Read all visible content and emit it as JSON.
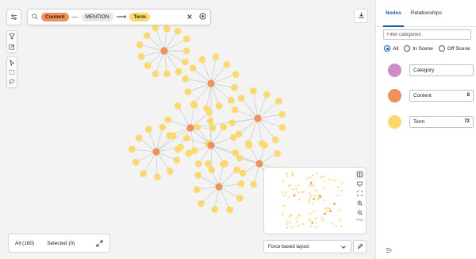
{
  "toolbar": {
    "filter_icon": "sliders-icon"
  },
  "search": {
    "source_label": "Content",
    "relationship_label": "MENTION",
    "target_label": "Term"
  },
  "bottom": {
    "all_label": "All (160)",
    "selected_label": "Selected (0)"
  },
  "minimap": {
    "label": "PNG"
  },
  "layout": {
    "selected": "Force-based layout"
  },
  "panel": {
    "tabs": [
      {
        "label": "Nodes",
        "active": true
      },
      {
        "label": "Relationships",
        "active": false
      }
    ],
    "filter_placeholder": "Filter categories",
    "scene_options": [
      {
        "label": "All",
        "checked": true
      },
      {
        "label": "In Scene",
        "checked": false
      },
      {
        "label": "Off Scene",
        "checked": false
      }
    ],
    "categories": [
      {
        "label": "Category",
        "count": "",
        "color": "#d08cc4"
      },
      {
        "label": "Content",
        "count": "8",
        "color": "#f0905a"
      },
      {
        "label": "Term",
        "count": "72",
        "color": "#fcd870"
      }
    ]
  },
  "colors": {
    "accent": "#1859b6",
    "content_node": "#f0905a",
    "term_node": "#fcd870",
    "category_node": "#d08cc4",
    "edge": "#c8cccc"
  }
}
